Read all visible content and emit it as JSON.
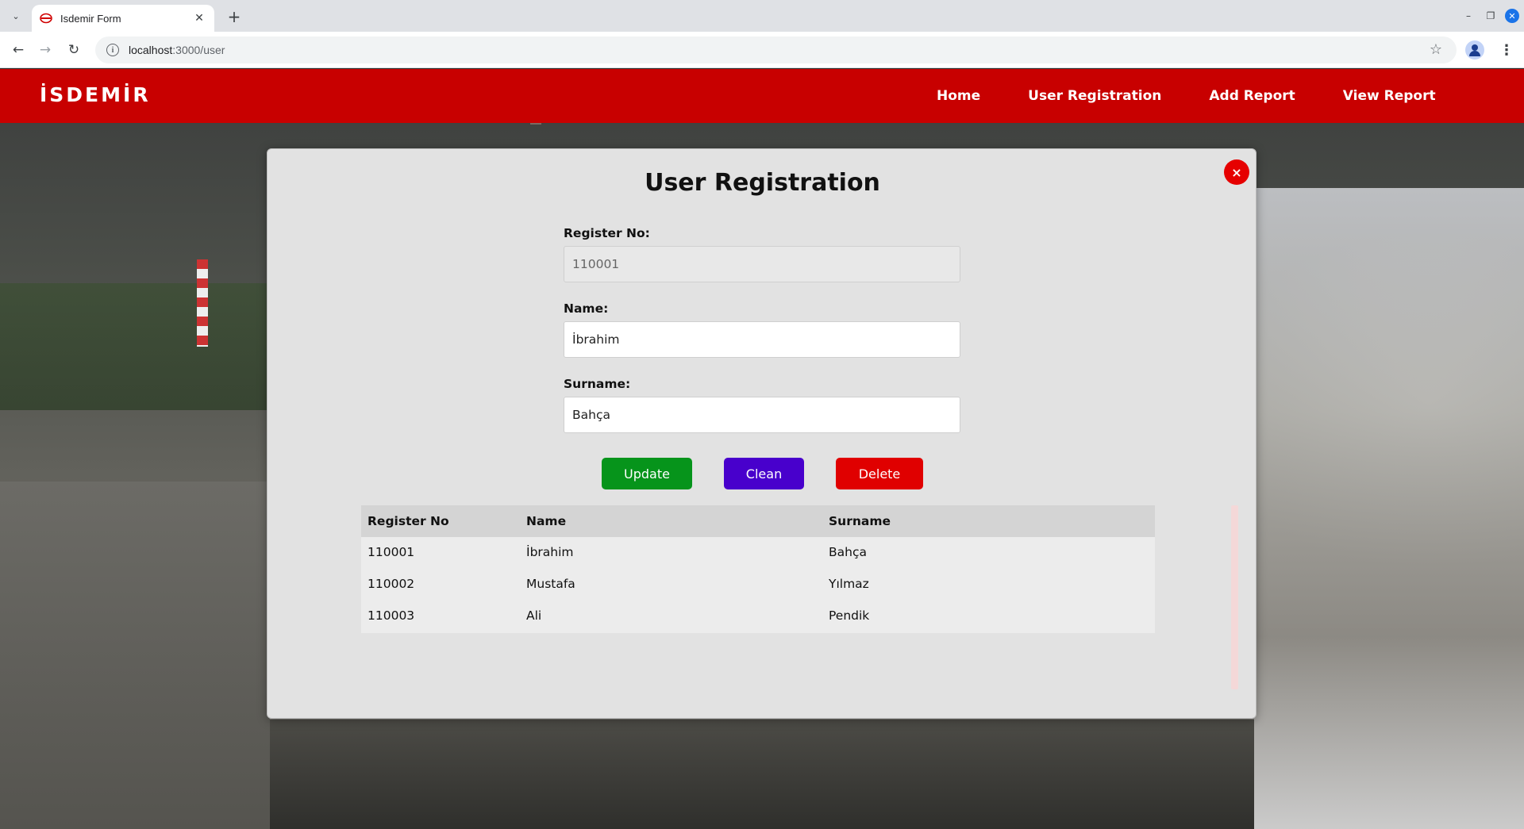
{
  "browser": {
    "tab_title": "Isdemir Form",
    "url_host": "localhost",
    "url_path": ":3000/user"
  },
  "navbar": {
    "logo": "İSDEMİR",
    "links": [
      "Home",
      "User Registration",
      "Add Report",
      "View Report"
    ]
  },
  "modal": {
    "title": "User Registration",
    "close_icon": "×",
    "fields": {
      "register_no": {
        "label": "Register No:",
        "value": "110001"
      },
      "name": {
        "label": "Name:",
        "value": "İbrahim"
      },
      "surname": {
        "label": "Surname:",
        "value": "Bahça"
      }
    },
    "buttons": {
      "update": "Update",
      "clean": "Clean",
      "delete": "Delete"
    },
    "colors": {
      "update": "#06941b",
      "clean": "#4800cc",
      "delete": "#e00000"
    },
    "table": {
      "headers": [
        "Register No",
        "Name",
        "Surname"
      ],
      "rows": [
        [
          "110001",
          "İbrahim",
          "Bahça"
        ],
        [
          "110002",
          "Mustafa",
          "Yılmaz"
        ],
        [
          "110003",
          "Ali",
          "Pendik"
        ]
      ]
    }
  },
  "theme": {
    "brand_red": "#c80000"
  }
}
